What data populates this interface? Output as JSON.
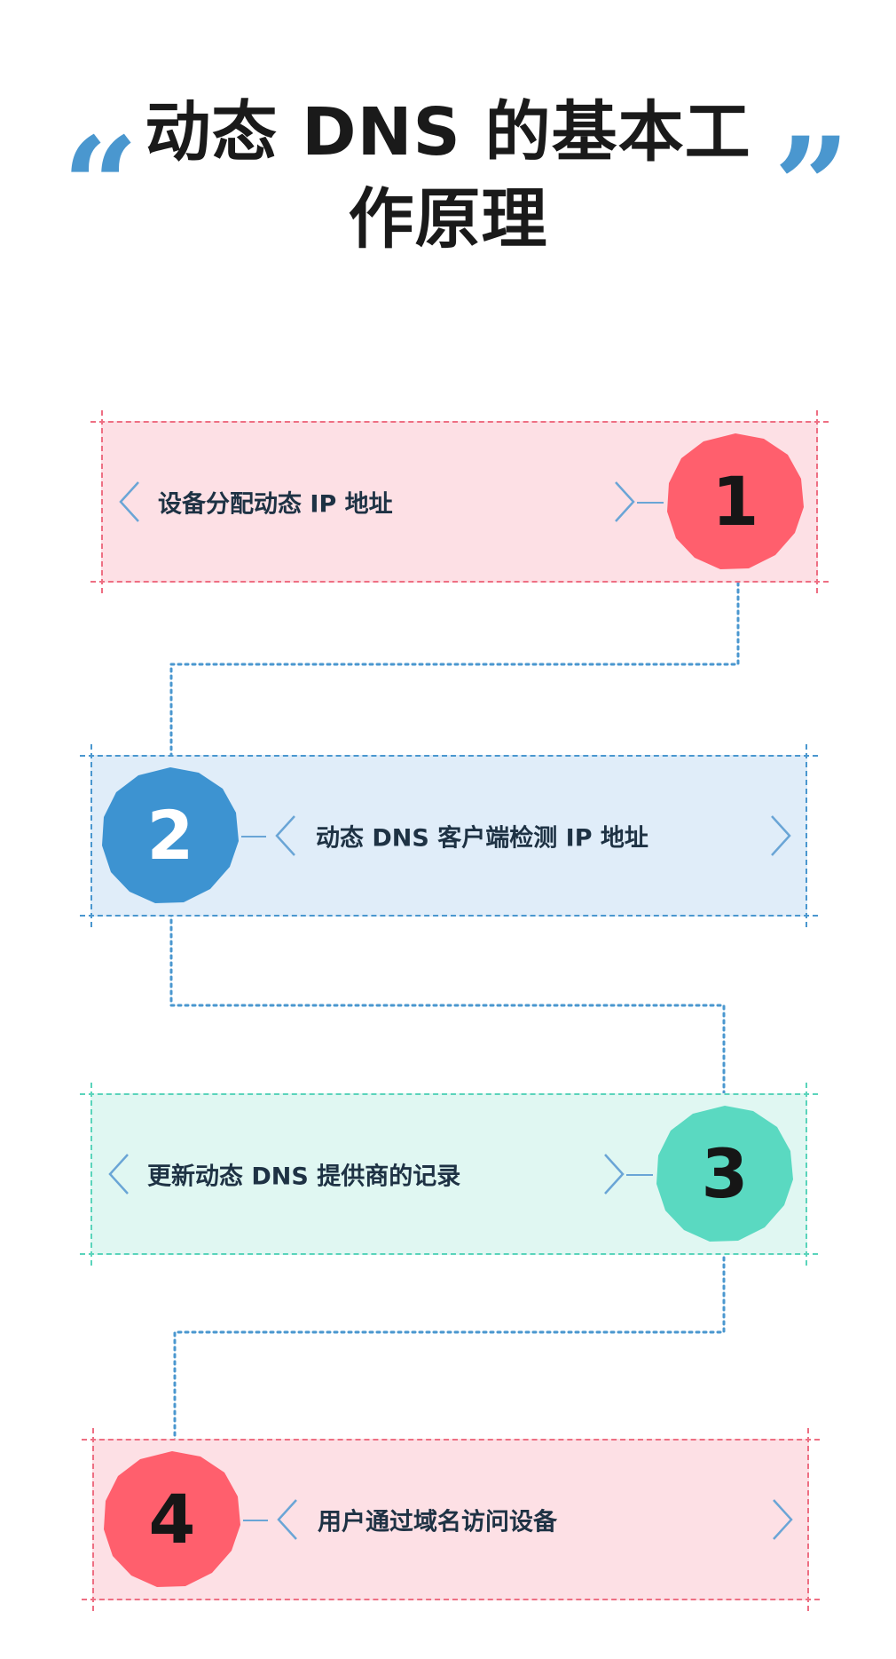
{
  "title": "动态 DNS 的基本工作原理",
  "quotes": {
    "open": "“",
    "close": "”"
  },
  "colors": {
    "red": "#ff5f6d",
    "blue": "#3d93d1",
    "teal": "#5ad9c1",
    "connector": "#4a97cf",
    "chevron": "#6aa5d6"
  },
  "steps": [
    {
      "number": "1",
      "label": "设备分配动态 IP 地址",
      "color": "red",
      "icon": "chevron-icon"
    },
    {
      "number": "2",
      "label": "动态 DNS 客户端检测 IP 地址",
      "color": "blue",
      "icon": "chevron-icon"
    },
    {
      "number": "3",
      "label": "更新动态 DNS 提供商的记录",
      "color": "teal",
      "icon": "chevron-icon"
    },
    {
      "number": "4",
      "label": "用户通过域名访问设备",
      "color": "red",
      "icon": "chevron-icon"
    }
  ]
}
